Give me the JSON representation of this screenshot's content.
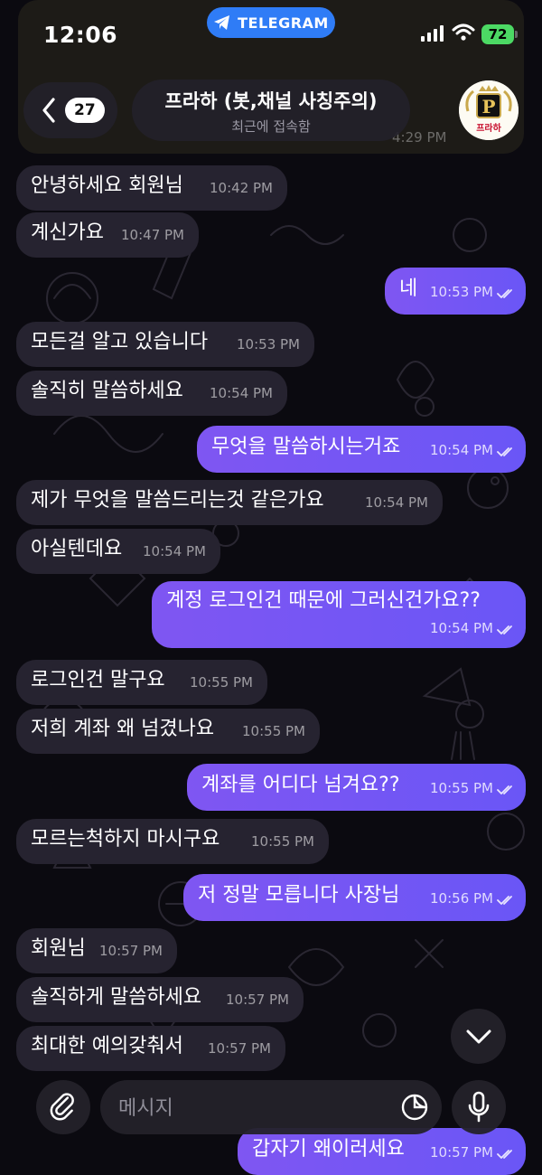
{
  "status_bar": {
    "time": "12:06",
    "app_pill": "TELEGRAM",
    "battery": "72"
  },
  "header": {
    "back_count": "27",
    "title": "프라하 (봇,채널 사칭주의)",
    "subtitle": "최근에 접속함",
    "avatar_label": "프라하",
    "avatar_letter": "P"
  },
  "previous_message_time": "4:29 PM",
  "messages": [
    {
      "dir": "in",
      "text": "안녕하세요 회원님",
      "time": "10:42 PM"
    },
    {
      "dir": "in",
      "text": "계신가요",
      "time": "10:47 PM"
    },
    {
      "dir": "out",
      "text": "네",
      "time": "10:53 PM"
    },
    {
      "dir": "in",
      "text": "모든걸 알고 있습니다",
      "time": "10:53 PM"
    },
    {
      "dir": "in",
      "text": "솔직히 말씀하세요",
      "time": "10:54 PM"
    },
    {
      "dir": "out",
      "text": "무엇을 말씀하시는거죠",
      "time": "10:54 PM"
    },
    {
      "dir": "in",
      "text": "제가 무엇을 말씀드리는것 같은가요",
      "time": "10:54 PM"
    },
    {
      "dir": "in",
      "text": "아실텐데요",
      "time": "10:54 PM"
    },
    {
      "dir": "out",
      "text": "계정 로그인건 때문에 그러신건가요??",
      "time": "10:54 PM"
    },
    {
      "dir": "in",
      "text": "로그인건 말구요",
      "time": "10:55 PM"
    },
    {
      "dir": "in",
      "text": "저희 계좌 왜 넘겼나요",
      "time": "10:55 PM"
    },
    {
      "dir": "out",
      "text": "계좌를 어디다 넘겨요??",
      "time": "10:55 PM"
    },
    {
      "dir": "in",
      "text": "모르는척하지 마시구요",
      "time": "10:55 PM"
    },
    {
      "dir": "out",
      "text": "저 정말 모릅니다 사장님",
      "time": "10:56 PM"
    },
    {
      "dir": "in",
      "text": "회원님",
      "time": "10:57 PM"
    },
    {
      "dir": "in",
      "text": "솔직하게 말씀하세요",
      "time": "10:57 PM"
    },
    {
      "dir": "in",
      "text": "최대한 예의갖춰서",
      "time": "10:57 PM"
    },
    {
      "dir": "out",
      "text": "갑자기 왜이러세요",
      "time": "10:57 PM"
    }
  ],
  "composer": {
    "placeholder": "메시지"
  },
  "colors": {
    "incoming_bubble": "#262330",
    "outgoing_bubble": "#7f56f2",
    "telegram_pill": "#2f7cf6",
    "battery": "#4cd964"
  },
  "icons": [
    "telegram-icon",
    "signal-icon",
    "wifi-icon",
    "back-chevron-icon",
    "read-checks-icon",
    "chevron-down-icon",
    "paperclip-icon",
    "sticker-icon",
    "microphone-icon"
  ]
}
